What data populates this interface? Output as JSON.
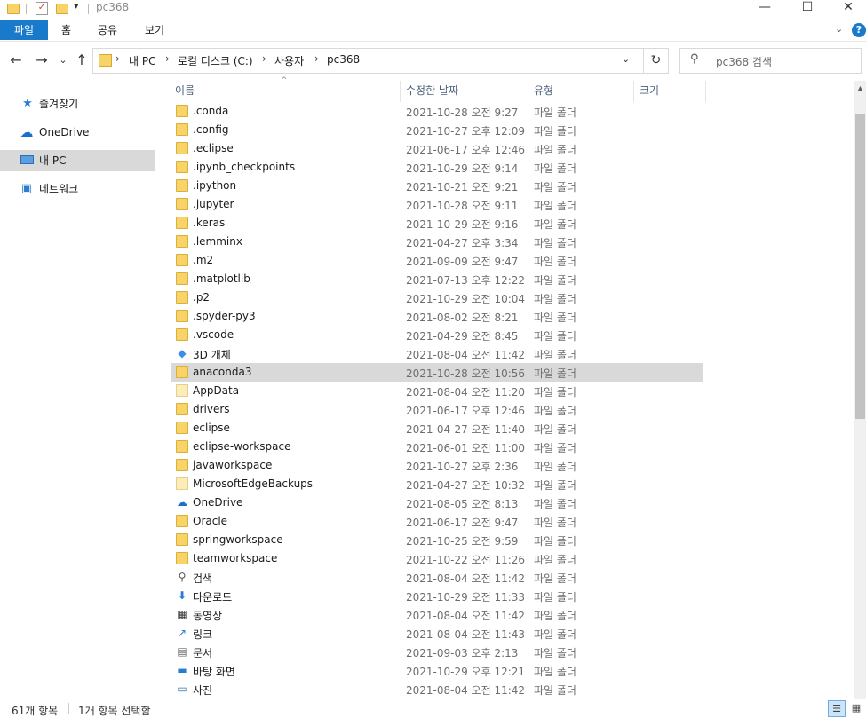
{
  "window": {
    "title": "pc368",
    "quick_access_dropdown": "▾"
  },
  "window_controls": {
    "minimize": "—",
    "maximize": "☐",
    "close": "✕"
  },
  "ribbon": {
    "file_tab": "파일",
    "tabs": [
      "홈",
      "공유",
      "보기"
    ],
    "expand_glyph": "⌄",
    "help_glyph": "?"
  },
  "nav": {
    "back": "←",
    "forward": "→",
    "recent": "⌄",
    "up": "↑",
    "refresh": "↻"
  },
  "address": {
    "separator": "›",
    "crumbs": [
      "내 PC",
      "로컬 디스크 (C:)",
      "사용자",
      "pc368"
    ],
    "dropdown": "⌄"
  },
  "search": {
    "placeholder": "pc368 검색"
  },
  "navpane": {
    "items": [
      {
        "label": "즐겨찾기",
        "icon": "star-icon"
      },
      {
        "label": "OneDrive",
        "icon": "cloud-icon"
      },
      {
        "label": "내 PC",
        "icon": "computer-icon",
        "selected": true
      },
      {
        "label": "네트워크",
        "icon": "network-icon"
      }
    ]
  },
  "columns": {
    "name": "이름",
    "date": "수정한 날짜",
    "type": "유형",
    "size": "크기",
    "sort_glyph": "^"
  },
  "files": [
    {
      "name": ".conda",
      "date": "2021-10-28 오전 9:27",
      "type": "파일 폴더",
      "icon": "folder-icon"
    },
    {
      "name": ".config",
      "date": "2021-10-27 오후 12:09",
      "type": "파일 폴더",
      "icon": "folder-icon"
    },
    {
      "name": ".eclipse",
      "date": "2021-06-17 오후 12:46",
      "type": "파일 폴더",
      "icon": "folder-icon"
    },
    {
      "name": ".ipynb_checkpoints",
      "date": "2021-10-29 오전 9:14",
      "type": "파일 폴더",
      "icon": "folder-icon"
    },
    {
      "name": ".ipython",
      "date": "2021-10-21 오전 9:21",
      "type": "파일 폴더",
      "icon": "folder-icon"
    },
    {
      "name": ".jupyter",
      "date": "2021-10-28 오전 9:11",
      "type": "파일 폴더",
      "icon": "folder-icon"
    },
    {
      "name": ".keras",
      "date": "2021-10-29 오전 9:16",
      "type": "파일 폴더",
      "icon": "folder-icon"
    },
    {
      "name": ".lemminx",
      "date": "2021-04-27 오후 3:34",
      "type": "파일 폴더",
      "icon": "folder-icon"
    },
    {
      "name": ".m2",
      "date": "2021-09-09 오전 9:47",
      "type": "파일 폴더",
      "icon": "folder-icon"
    },
    {
      "name": ".matplotlib",
      "date": "2021-07-13 오후 12:22",
      "type": "파일 폴더",
      "icon": "folder-icon"
    },
    {
      "name": ".p2",
      "date": "2021-10-29 오전 10:04",
      "type": "파일 폴더",
      "icon": "folder-icon"
    },
    {
      "name": ".spyder-py3",
      "date": "2021-08-02 오전 8:21",
      "type": "파일 폴더",
      "icon": "folder-icon"
    },
    {
      "name": ".vscode",
      "date": "2021-04-29 오전 8:45",
      "type": "파일 폴더",
      "icon": "folder-icon"
    },
    {
      "name": "3D 개체",
      "date": "2021-08-04 오전 11:42",
      "type": "파일 폴더",
      "icon": "cube-icon"
    },
    {
      "name": "anaconda3",
      "date": "2021-10-28 오전 10:56",
      "type": "파일 폴더",
      "icon": "folder-icon",
      "selected": true
    },
    {
      "name": "AppData",
      "date": "2021-08-04 오전 11:20",
      "type": "파일 폴더",
      "icon": "hidden-folder-icon"
    },
    {
      "name": "drivers",
      "date": "2021-06-17 오후 12:46",
      "type": "파일 폴더",
      "icon": "folder-icon"
    },
    {
      "name": "eclipse",
      "date": "2021-04-27 오전 11:40",
      "type": "파일 폴더",
      "icon": "folder-icon"
    },
    {
      "name": "eclipse-workspace",
      "date": "2021-06-01 오전 11:00",
      "type": "파일 폴더",
      "icon": "folder-icon"
    },
    {
      "name": "javaworkspace",
      "date": "2021-10-27 오후 2:36",
      "type": "파일 폴더",
      "icon": "folder-icon"
    },
    {
      "name": "MicrosoftEdgeBackups",
      "date": "2021-04-27 오전 10:32",
      "type": "파일 폴더",
      "icon": "hidden-folder-icon"
    },
    {
      "name": "OneDrive",
      "date": "2021-08-05 오전 8:13",
      "type": "파일 폴더",
      "icon": "cloud-icon"
    },
    {
      "name": "Oracle",
      "date": "2021-06-17 오전 9:47",
      "type": "파일 폴더",
      "icon": "folder-icon"
    },
    {
      "name": "springworkspace",
      "date": "2021-10-25 오전 9:59",
      "type": "파일 폴더",
      "icon": "folder-icon"
    },
    {
      "name": "teamworkspace",
      "date": "2021-10-22 오전 11:26",
      "type": "파일 폴더",
      "icon": "folder-icon"
    },
    {
      "name": "검색",
      "date": "2021-08-04 오전 11:42",
      "type": "파일 폴더",
      "icon": "search-folder-icon"
    },
    {
      "name": "다운로드",
      "date": "2021-10-29 오전 11:33",
      "type": "파일 폴더",
      "icon": "download-icon"
    },
    {
      "name": "동영상",
      "date": "2021-08-04 오전 11:42",
      "type": "파일 폴더",
      "icon": "video-icon"
    },
    {
      "name": "링크",
      "date": "2021-08-04 오전 11:43",
      "type": "파일 폴더",
      "icon": "link-icon"
    },
    {
      "name": "문서",
      "date": "2021-09-03 오후 2:13",
      "type": "파일 폴더",
      "icon": "document-icon"
    },
    {
      "name": "바탕 화면",
      "date": "2021-10-29 오후 12:21",
      "type": "파일 폴더",
      "icon": "desktop-icon"
    },
    {
      "name": "사진",
      "date": "2021-08-04 오전 11:42",
      "type": "파일 폴더",
      "icon": "picture-icon"
    }
  ],
  "status": {
    "count": "61개 항목",
    "selection": "1개 항목 선택함"
  },
  "view_buttons": {
    "details": "☰",
    "large_icons": "▦"
  },
  "colors": {
    "accent": "#1979ca",
    "folder": "#f8d468",
    "selection": "#d9d9d9"
  }
}
